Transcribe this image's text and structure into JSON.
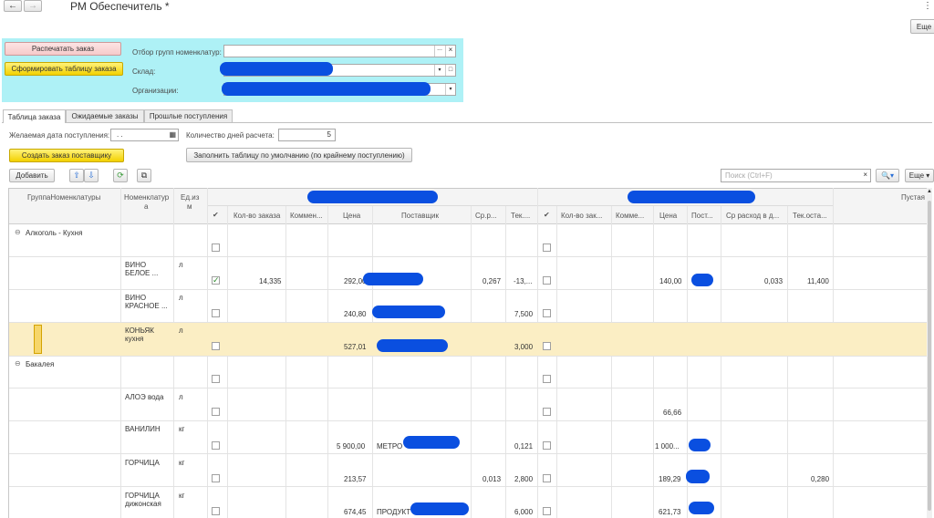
{
  "title": "РМ Обеспечитель *",
  "more_top": "Еще",
  "top": {
    "print_button": "Распечатать заказ",
    "form_button": "Сформировать таблицу заказа",
    "filter_label": "Отбор групп номенклатур:",
    "warehouse_label": "Склад:",
    "org_label": "Организации:"
  },
  "tabs": [
    "Таблица заказа",
    "Ожидаемые заказы",
    "Прошлые поступления"
  ],
  "form": {
    "date_label": "Желаемая дата поступления:",
    "date_value": ". .",
    "days_label": "Количество дней расчета:",
    "days_value": "5",
    "create_button": "Создать заказ поставщику",
    "fill_button": "Заполнить таблицу по умолчанию (по крайнему поступлению)"
  },
  "toolbar": {
    "add": "Добавить",
    "search_placeholder": "Поиск (Ctrl+F)",
    "more": "Еще"
  },
  "grid": {
    "col_group": "ГруппаНоменклатуры",
    "col_nom1": "Номенклатур",
    "col_nom2": "а",
    "col_unit1": "Ед.из",
    "col_unit2": "м",
    "col_empty": "Пустая",
    "check_mark": "✔",
    "sub1": [
      "Кол-во заказа",
      "Коммен...",
      "Цена",
      "Поставщик",
      "Ср.р...",
      "Тек...."
    ],
    "sub2": [
      "Кол-во зак...",
      "Комме...",
      "Цена",
      "Пост...",
      "Ср расход в д...",
      "Тек.оста..."
    ],
    "groups": [
      "Алкоголь - Кухня",
      "Бакалея"
    ],
    "rows": [
      {
        "name1": "ВИНО",
        "name2": "БЕЛОЕ ...",
        "unit": "л",
        "qty": "14,335",
        "price": "292,00",
        "avg": "0,267",
        "cur": "-13,...",
        "price2": "140,00",
        "avg2": "0,033",
        "cur2": "11,400"
      },
      {
        "name1": "ВИНО",
        "name2": "КРАСНОЕ ...",
        "unit": "л",
        "price": "240,80",
        "cur": "7,500"
      },
      {
        "name1": "КОНЬЯК",
        "name2": "кухня",
        "unit": "л",
        "price": "527,01",
        "cur": "3,000"
      },
      {
        "name1": "АЛОЭ вода",
        "unit": "л",
        "price2": "66,66"
      },
      {
        "name1": "ВАНИЛИН",
        "unit": "кг",
        "price": "5 900,00",
        "supplier": "МЕТРО",
        "cur": "0,121",
        "price2": "1 000..."
      },
      {
        "name1": "ГОРЧИЦА",
        "unit": "кг",
        "price": "213,57",
        "avg": "0,013",
        "cur": "2,800",
        "price2": "189,29",
        "cur2": "0,280"
      },
      {
        "name1": "ГОРЧИЦА",
        "name2": "дижонская",
        "unit": "кг",
        "price": "674,45",
        "supplier": "ПРОДУКТ",
        "cur": "6,000",
        "price2": "621,73"
      }
    ]
  }
}
